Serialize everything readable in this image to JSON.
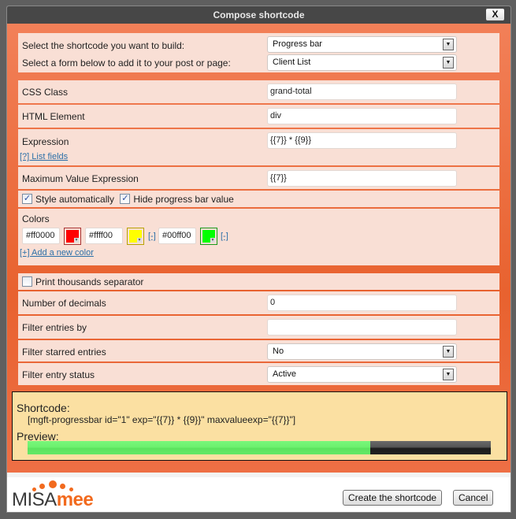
{
  "dialog": {
    "title": "Compose shortcode",
    "close_label": "X"
  },
  "selectors": {
    "shortcode_label": "Select the shortcode you want to build:",
    "shortcode_value": "Progress bar",
    "form_label": "Select a form below to add it to your post or page:",
    "form_value": "Client List"
  },
  "fields": {
    "css_class": {
      "label": "CSS Class",
      "value": "grand-total"
    },
    "html_element": {
      "label": "HTML Element",
      "value": "div"
    },
    "expression": {
      "label": "Expression",
      "value": "{{7}} * {{9}}",
      "help_link": "[?] List fields"
    },
    "max_value_expression": {
      "label": "Maximum Value Expression",
      "value": "{{7}}"
    },
    "style_automatically": {
      "label": "Style automatically",
      "checked": true
    },
    "hide_value": {
      "label": "Hide progress bar value",
      "checked": true
    },
    "colors": {
      "label": "Colors",
      "items": [
        {
          "value": "#ff0000",
          "removable": false
        },
        {
          "value": "#ffff00",
          "removable": true
        },
        {
          "value": "#00ff00",
          "removable": true
        }
      ],
      "remove_label": "[-]",
      "add_link": "[+] Add a new color"
    },
    "thousands_separator": {
      "label": "Print thousands separator",
      "checked": false
    },
    "decimals": {
      "label": "Number of decimals",
      "value": "0"
    },
    "filter_entries": {
      "label": "Filter entries by",
      "value": ""
    },
    "filter_starred": {
      "label": "Filter starred entries",
      "value": "No"
    },
    "filter_status": {
      "label": "Filter entry status",
      "value": "Active"
    }
  },
  "output": {
    "shortcode_title": "Shortcode:",
    "shortcode_text": "[mgft-progressbar id=\"1\" exp=\"{{7}} * {{9}}\" maxvalueexp=\"{{7}}\"]",
    "preview_title": "Preview:",
    "preview_progress": 0.74,
    "preview_color": "#6cf06e"
  },
  "footer": {
    "logo_part1": "MISA",
    "logo_part2": "mee",
    "create_button": "Create the shortcode",
    "cancel_button": "Cancel"
  },
  "theme": {
    "accent": "#e8622f",
    "panel": "#f9dfd5",
    "titlebar": "#474747",
    "shortcode_bg": "#fbe0a2"
  }
}
